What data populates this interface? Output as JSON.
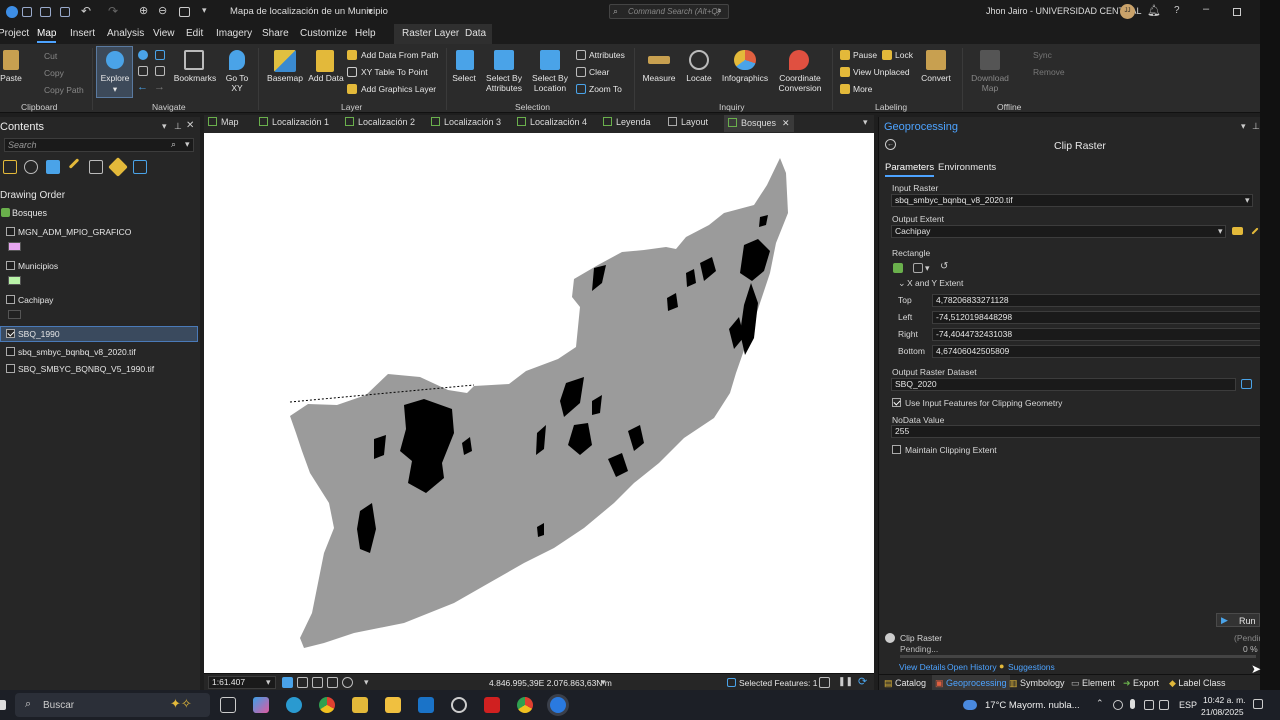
{
  "window": {
    "title": "Mapa de localización de un Municipio",
    "command_search_placeholder": "Command Search (Alt+Q)",
    "user": "Jhon Jairo - UNIVERSIDAD CENTRAL",
    "avatar_initials": "JJ"
  },
  "menu": [
    "Project",
    "Map",
    "Insert",
    "Analysis",
    "View",
    "Edit",
    "Imagery",
    "Share",
    "Customize",
    "Help",
    "Raster Layer",
    "Data"
  ],
  "ribbon": {
    "clipboard": {
      "paste": "Paste",
      "cut": "Cut",
      "copy": "Copy",
      "copy_path": "Copy Path",
      "group": "Clipboard"
    },
    "navigate": {
      "explore": "Explore",
      "bookmarks": "Bookmarks",
      "goto": "Go To XY",
      "group": "Navigate"
    },
    "layer": {
      "basemap": "Basemap",
      "add_data": "Add Data",
      "add_data_path": "Add Data From Path",
      "xy_table": "XY Table To Point",
      "add_graphics": "Add Graphics Layer",
      "group": "Layer"
    },
    "selection": {
      "select": "Select",
      "select_by_attr": "Select By Attributes",
      "select_by_loc": "Select By Location",
      "attributes": "Attributes",
      "clear": "Clear",
      "zoom_to": "Zoom To",
      "group": "Selection"
    },
    "inquiry": {
      "measure": "Measure",
      "locate": "Locate",
      "infographics": "Infographics",
      "coord_conv": "Coordinate Conversion",
      "group": "Inquiry"
    },
    "labeling": {
      "pause": "Pause",
      "lock": "Lock",
      "view_unplaced": "View Unplaced",
      "more": "More",
      "convert": "Convert",
      "group": "Labeling"
    },
    "offline": {
      "download": "Download Map",
      "sync": "Sync",
      "remove": "Remove",
      "group": "Offline"
    }
  },
  "contents": {
    "title": "Contents",
    "search_placeholder": "Search",
    "drawing_order": "Drawing Order",
    "map_name": "Bosques",
    "layers": [
      {
        "name": "MGN_ADM_MPIO_GRAFICO",
        "swatch": "#e7a6f0",
        "checked": false
      },
      {
        "name": "Municipios",
        "swatch": "#b9f3a8",
        "checked": false
      },
      {
        "name": "Cachipay",
        "swatch": "#222222",
        "checked": false
      },
      {
        "name": "SBQ_1990",
        "checked": true,
        "selected": true
      },
      {
        "name": "sbq_smbyc_bqnbq_v8_2020.tif",
        "checked": false
      },
      {
        "name": "SBQ_SMBYC_BQNBQ_V5_1990.tif",
        "checked": false
      }
    ]
  },
  "map_tabs": [
    "Map",
    "Localización 1",
    "Localización 2",
    "Localización 3",
    "Localización 4",
    "Leyenda",
    "Layout",
    "Bosques"
  ],
  "statusbar": {
    "scale": "1:61.407",
    "coordinates": "4.846.995,39E 2.076.863,63N m",
    "selected": "Selected Features: 1"
  },
  "geoprocessing": {
    "panel_title": "Geoprocessing",
    "tool_title": "Clip Raster",
    "tabs": [
      "Parameters",
      "Environments"
    ],
    "input_raster_label": "Input Raster",
    "input_raster": "sbq_smbyc_bqnbq_v8_2020.tif",
    "output_extent_label": "Output Extent",
    "output_extent": "Cachipay",
    "rectangle_label": "Rectangle",
    "xy_extent_label": "X and Y Extent",
    "top_label": "Top",
    "top": "4,78206833271128",
    "left_label": "Left",
    "left": "-74,5120198448298",
    "right_label": "Right",
    "right": "-74,4044732431038",
    "bottom_label": "Bottom",
    "bottom": "4,67406042505809",
    "output_dataset_label": "Output Raster Dataset",
    "output_dataset": "SBQ_2020",
    "use_input_features": "Use Input Features for Clipping Geometry",
    "nodata_label": "NoData Value",
    "nodata": "255",
    "maintain_extent": "Maintain Clipping Extent",
    "run": "Run",
    "job_name": "Clip Raster",
    "job_status": "Pending...",
    "job_pending": "(Pendin",
    "job_progress_text": "0 %",
    "job_progress": 0,
    "view_details": "View Details",
    "open_history": "Open History",
    "suggestions": "Suggestions",
    "bottom_tabs": [
      "Catalog",
      "Geoprocessing",
      "Symbology",
      "Element",
      "Export",
      "Label Class"
    ]
  },
  "taskbar": {
    "search_placeholder": "Buscar",
    "weather": "17°C  Mayorm. nubla...",
    "lang": "ESP",
    "time": "10:42 a. m.",
    "date": "21/08/2025"
  }
}
